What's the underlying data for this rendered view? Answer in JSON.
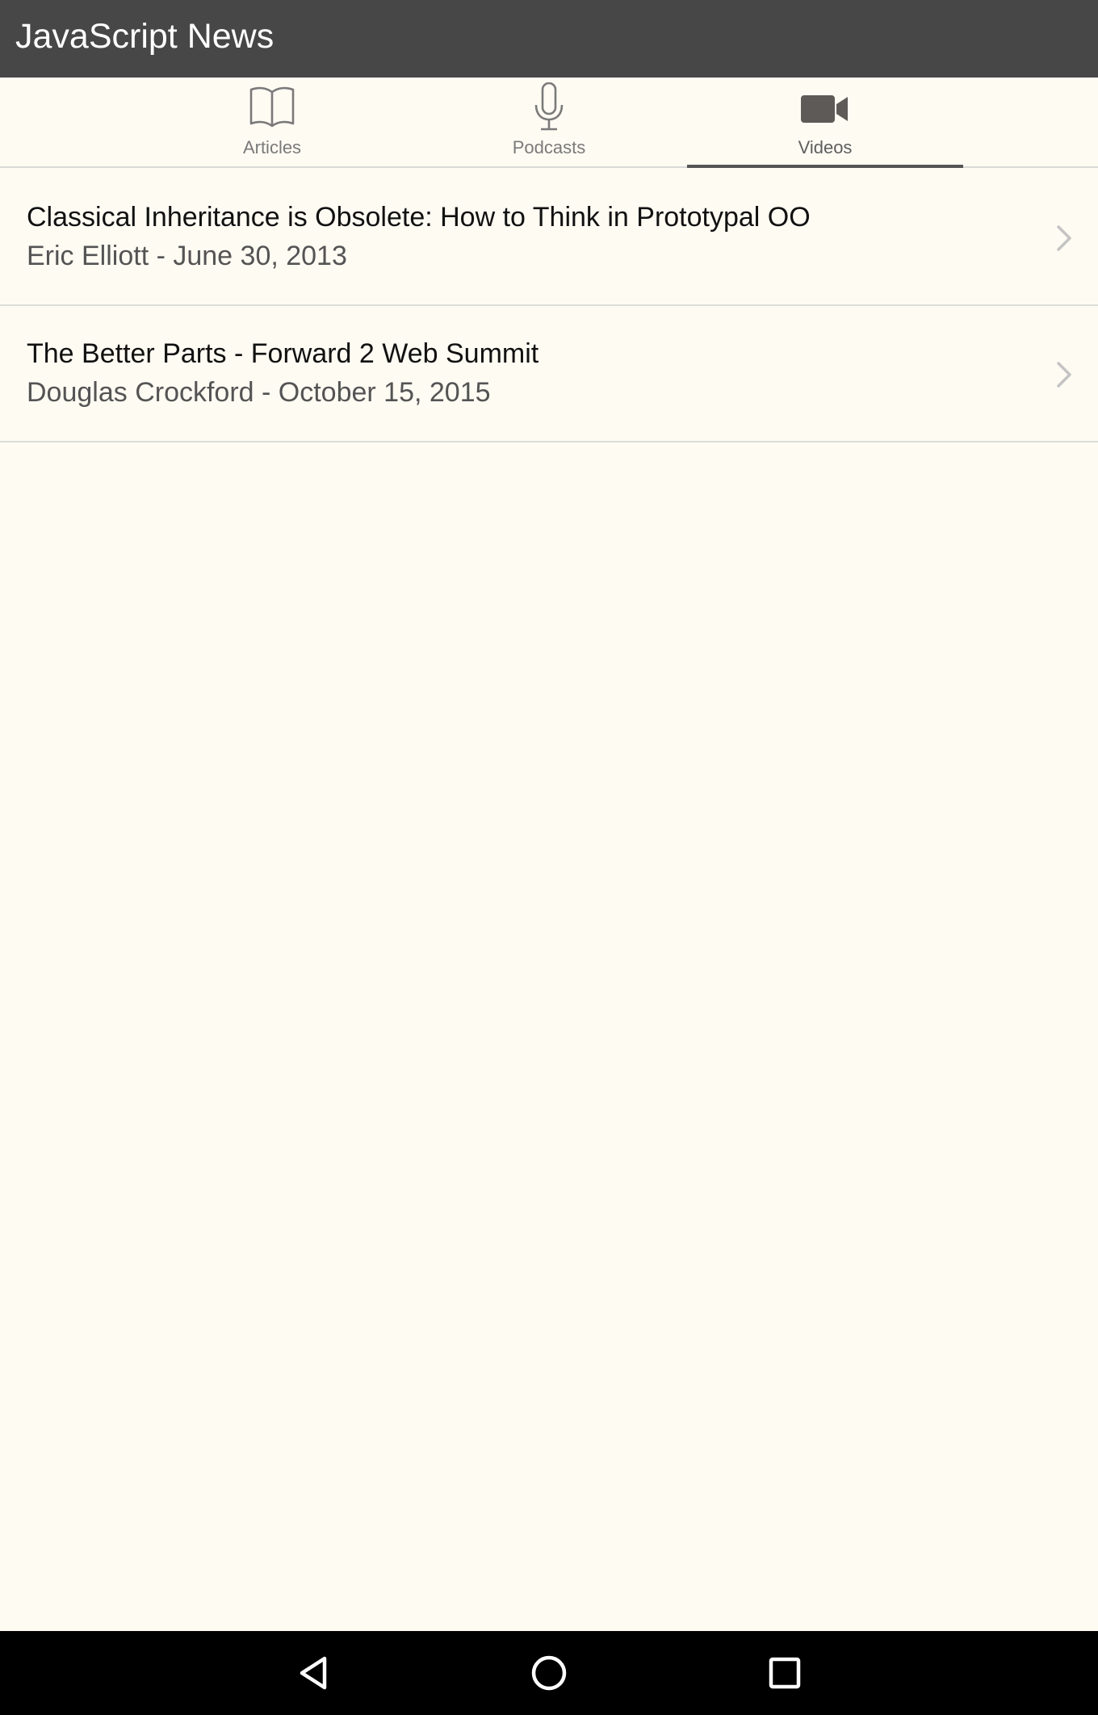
{
  "app": {
    "title": "JavaScript News"
  },
  "tabs": [
    {
      "label": "Articles",
      "icon": "book-icon",
      "active": false
    },
    {
      "label": "Podcasts",
      "icon": "microphone-icon",
      "active": false
    },
    {
      "label": "Videos",
      "icon": "video-camera-icon",
      "active": true
    }
  ],
  "videos": [
    {
      "title": "Classical Inheritance is Obsolete: How to Think in Prototypal OO",
      "subtitle": "Eric Elliott - June 30, 2013"
    },
    {
      "title": "The Better Parts - Forward 2 Web Summit",
      "subtitle": "Douglas Crockford - October 15, 2015"
    }
  ],
  "navbar": {
    "back": "back-triangle-icon",
    "home": "home-circle-icon",
    "recents": "recents-square-icon"
  },
  "colors": {
    "titlebar": "#474747",
    "background": "#fefbf3",
    "navbar": "#000000"
  }
}
